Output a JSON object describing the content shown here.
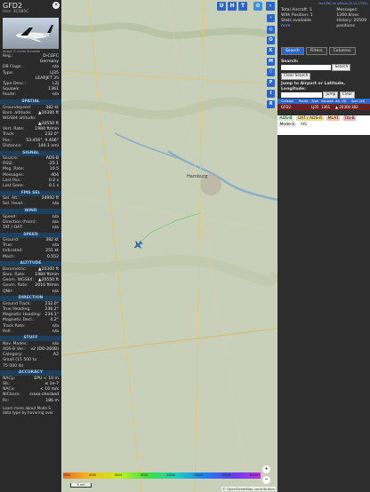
{
  "left": {
    "callsign": "GFD2",
    "hex_label": "Hex: 3C085C",
    "close_label": "×",
    "photo_credit": "Image © Andre Ehmelde",
    "top_rows": [
      {
        "k": "Reg.:",
        "v": "D-CGFC",
        "link": true
      },
      {
        "k": "",
        "v": "Germany"
      },
      {
        "k": "DB Flags:",
        "v": "n/a"
      },
      {
        "k": "Type:",
        "v": "LJ35"
      },
      {
        "k": "",
        "v": "LEARJET 35"
      },
      {
        "k": "Type Desc.:",
        "v": "L2J"
      },
      {
        "k": "Squawk:",
        "v": "1361"
      },
      {
        "k": "Route:",
        "v": "n/a"
      }
    ],
    "sections": [
      {
        "title": "SPATIAL",
        "rows": [
          {
            "k": "Groundspeed:",
            "v": "382 kt"
          },
          {
            "k": "Baro. altitude:",
            "v": "▲20300 ft"
          },
          {
            "k": "WGS84 altitude:",
            "v": ""
          },
          {
            "k": "",
            "v": "▲20550 ft"
          },
          {
            "k": "Vert. Rate:",
            "v": "1984 ft/min"
          },
          {
            "k": "Track:",
            "v": "232.0°"
          },
          {
            "k": "Pos.:",
            "v": "53.456°, 9.406°"
          },
          {
            "k": "Distance:",
            "v": "140.1 nmi"
          }
        ]
      },
      {
        "title": "SIGNAL",
        "rows": [
          {
            "k": "Source:",
            "v": "ADS-B"
          },
          {
            "k": "RSSI:",
            "v": "-25.1"
          },
          {
            "k": "Msg. Rate:",
            "v": "10.5"
          },
          {
            "k": "Messages:",
            "v": "404"
          },
          {
            "k": "Last Pos.:",
            "v": "0.2 s"
          },
          {
            "k": "Last Seen:",
            "v": "0.1 s"
          }
        ]
      },
      {
        "title": "FMS SEL",
        "rows": [
          {
            "k": "Sel. Alt.:",
            "v": "24992 ft"
          },
          {
            "k": "Sel. Head.:",
            "v": "n/a"
          }
        ]
      },
      {
        "title": "WIND",
        "rows": [
          {
            "k": "Speed:",
            "v": "n/a"
          },
          {
            "k": "Direction (from):",
            "v": "n/a"
          },
          {
            "k": "TAT / OAT:",
            "v": "n/a"
          }
        ]
      },
      {
        "title": "SPEED",
        "rows": [
          {
            "k": "Ground:",
            "v": "382 kt"
          },
          {
            "k": "True:",
            "v": "n/a"
          },
          {
            "k": "Indicated:",
            "v": "251 kt"
          },
          {
            "k": "Mach:",
            "v": "0.552"
          }
        ]
      },
      {
        "title": "ALTITUDE",
        "rows": [
          {
            "k": "Barometric:",
            "v": "▲20300 ft"
          },
          {
            "k": "Baro. Rate:",
            "v": "1984 ft/min"
          },
          {
            "k": "Geom. WGS84:",
            "v": "▲20550 ft"
          },
          {
            "k": "Geom. Rate:",
            "v": "2016 ft/min"
          },
          {
            "k": "QNH:",
            "v": "n/a"
          }
        ]
      },
      {
        "title": "DIRECTION",
        "rows": [
          {
            "k": "Ground Track:",
            "v": "232.0°"
          },
          {
            "k": "True Heading:",
            "v": "236.2°"
          },
          {
            "k": "Magnetic Heading:",
            "v": "234.1°"
          },
          {
            "k": "Magnetic Decl.:",
            "v": "4.2°"
          },
          {
            "k": "Track Rate:",
            "v": "n/a"
          },
          {
            "k": "Roll:",
            "v": "n/a"
          }
        ]
      },
      {
        "title": "STUFF",
        "rows": [
          {
            "k": "Nav. Modes:",
            "v": "n/a"
          },
          {
            "k": "ADS-B Ver.:",
            "v": "v2 (DO-260B)"
          },
          {
            "k": "Category:",
            "v": "A2"
          },
          {
            "k": "Small (15 500 to",
            "v": ""
          },
          {
            "k": "75 000 lb)",
            "v": ""
          }
        ]
      },
      {
        "title": "ACCURACY",
        "rows": [
          {
            "k": "NACp:",
            "v": "EPU < 10 m"
          },
          {
            "k": "SIL:",
            "v": "≤ 1e-7"
          },
          {
            "k": "NACv:",
            "v": "< 10 m/s"
          },
          {
            "k": "NICbaro:",
            "v": "cross-checked"
          },
          {
            "k": "Rc:",
            "v": "186 m"
          }
        ]
      }
    ],
    "footer": "Learn more about Mode S data type by hovering over"
  },
  "map": {
    "top_buttons": [
      "U",
      "H",
      "T"
    ],
    "side_buttons": [
      "O",
      "K",
      "M",
      "P",
      "I",
      "R"
    ],
    "city_label": "Hamburg",
    "zoom_in": "+",
    "zoom_out": "−",
    "scale_label": "5 nm",
    "attribution": "© OpenStreetMap contributors",
    "altitude_ticks": [
      "2000",
      "4000",
      "6000",
      "8000",
      "10000",
      "20000",
      "30000",
      "40000+"
    ]
  },
  "right": {
    "top_link": "tar1090 on github (3.14.1739)",
    "total_aircraft": "Total Aircraft: 1",
    "with_position": "With Position: 1",
    "messages_label": "Messages:",
    "messages_value": "1360.8/sec",
    "history_label": "History: 20509",
    "history_value": "positions",
    "stats_label": "Stats available",
    "stats_link": "here",
    "tabs": [
      "Search",
      "Filters",
      "Columns"
    ],
    "search_label": "Search:",
    "search_button": "Search",
    "clear_search": "Clear Search",
    "jump_label": "Jump to Airport or Latitude, Longitude:",
    "jump_button": "Jump",
    "clear_button": "Clear",
    "table_headers": [
      "Callsign",
      "Route",
      "Type",
      "Squawk",
      "Alt. (ft)",
      "Spd. (kt)"
    ],
    "table_row": [
      "GFD2",
      "",
      "LJ35",
      "1361",
      "▲ 20300",
      "382"
    ],
    "legend": [
      "ADS-B",
      "UAT / ADS-R",
      "MLAT",
      "TIS-B",
      "Mode-S",
      "AIS"
    ]
  }
}
